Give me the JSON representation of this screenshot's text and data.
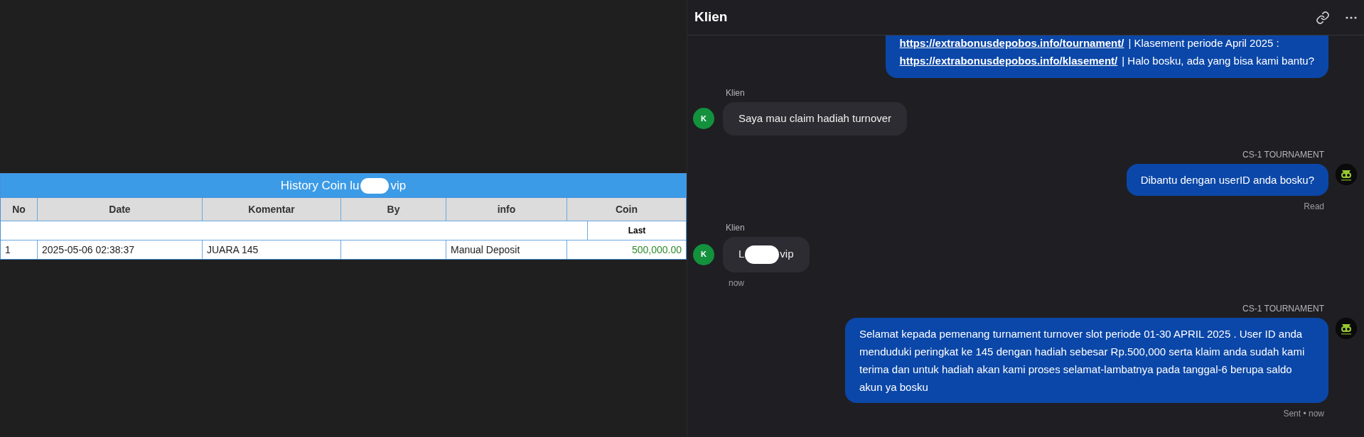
{
  "history_table": {
    "title_start": "History Coin lu",
    "title_end": "vip",
    "title_redacted": true,
    "columns": [
      "No",
      "Date",
      "Komentar",
      "By",
      "info",
      "Coin"
    ],
    "subheader": "Last",
    "rows": [
      {
        "cells": [
          "1",
          "2025-05-06 02:38:37",
          "JUARA 145",
          "",
          "Manual Deposit",
          "500,000.00"
        ]
      }
    ]
  },
  "chat": {
    "title": "Klien",
    "messages": [
      {
        "kind": "outgoing",
        "cut_top": true,
        "lines": [
          [
            {
              "kind": "link",
              "text": "https://extrabonusdepobos.info/tournament/"
            },
            {
              "kind": "text",
              "text": "| Klasement periode April 2025 :"
            }
          ],
          [
            {
              "kind": "link",
              "text": "https://extrabonusdepobos.info/klasement/"
            },
            {
              "kind": "text",
              "text": "| Halo bosku, ada yang bisa kami bantu?"
            }
          ]
        ]
      },
      {
        "kind": "incoming",
        "sender": "Klien",
        "avatar": "K",
        "text": "Saya mau claim hadiah turnover"
      },
      {
        "kind": "outgoing",
        "sender": "CS-1 TOURNAMENT",
        "text": "Dibantu dengan userID anda bosku?",
        "status": "Read"
      },
      {
        "kind": "incoming",
        "sender": "Klien",
        "avatar": "K",
        "text_start": "L",
        "text_end": "vip",
        "redacted": true,
        "time": "now"
      },
      {
        "kind": "outgoing",
        "sender": "CS-1 TOURNAMENT",
        "text": "Selamat kepada pemenang turnament turnover slot periode 01-30 APRIL 2025 . User ID anda menduduki peringkat ke 145 dengan hadiah sebesar Rp.500,000 serta klaim anda sudah kami terima dan untuk hadiah akan kami proses selamat-lambatnya pada tanggal-6 berupa saldo akun ya bosku",
        "status": "Sent • now"
      }
    ]
  }
}
